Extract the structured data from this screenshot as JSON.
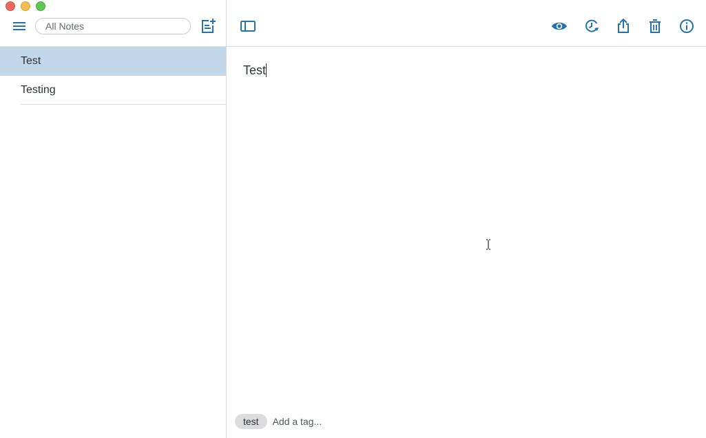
{
  "window": {
    "traffic_lights": [
      "close",
      "minimize",
      "maximize"
    ]
  },
  "sidebar": {
    "menu_icon": "hamburger-menu-icon",
    "search": {
      "placeholder": "All Notes",
      "value": ""
    },
    "new_note_icon": "new-note-icon",
    "notes": [
      {
        "title": "Test",
        "selected": true
      },
      {
        "title": "Testing",
        "selected": false
      }
    ]
  },
  "toolbar": {
    "icons": [
      "sidebar-toggle-icon",
      "preview-eye-icon",
      "history-icon",
      "share-icon",
      "trash-icon",
      "info-icon"
    ]
  },
  "editor": {
    "content": "Test"
  },
  "tags": {
    "items": [
      "test"
    ],
    "placeholder": "Add a tag..."
  },
  "colors": {
    "accent": "#2271b1",
    "selected_row": "#c3d7eb",
    "divider": "#d8dcdf",
    "tag_chip": "#dcdcde",
    "text": "#2c3338"
  }
}
